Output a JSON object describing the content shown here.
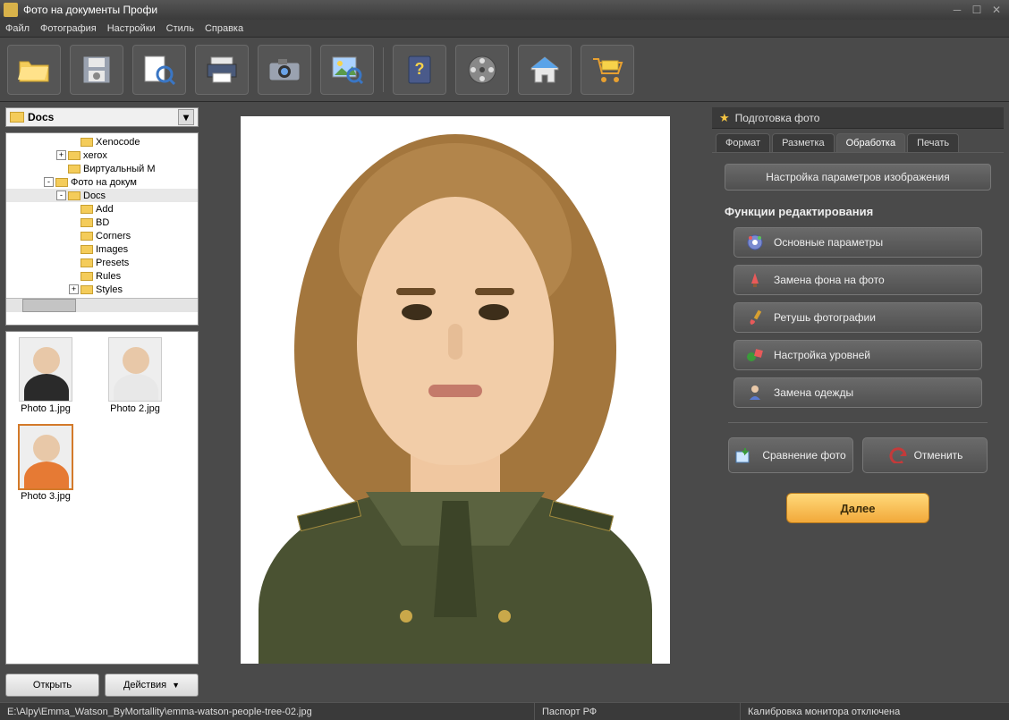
{
  "app": {
    "title": "Фото на документы Профи"
  },
  "menu": {
    "file": "Файл",
    "photo": "Фотография",
    "settings": "Настройки",
    "style": "Стиль",
    "help": "Справка"
  },
  "toolbar": {
    "items": [
      {
        "name": "open-folder-icon"
      },
      {
        "name": "save-icon"
      },
      {
        "name": "preview-icon"
      },
      {
        "name": "print-icon"
      },
      {
        "name": "camera-icon"
      },
      {
        "name": "image-search-icon"
      },
      {
        "sep": true
      },
      {
        "name": "help-book-icon"
      },
      {
        "name": "film-reel-icon"
      },
      {
        "name": "home-icon"
      },
      {
        "name": "shopping-cart-icon"
      }
    ]
  },
  "left": {
    "path_label": "Docs",
    "tree": [
      {
        "indent": 5,
        "label": "Xenocode",
        "exp": ""
      },
      {
        "indent": 4,
        "label": "xerox",
        "exp": "+"
      },
      {
        "indent": 4,
        "label": "Виртуальный М",
        "exp": ""
      },
      {
        "indent": 3,
        "label": "Фото на докум",
        "exp": "-"
      },
      {
        "indent": 4,
        "label": "Docs",
        "exp": "-",
        "sel": true
      },
      {
        "indent": 5,
        "label": "Add",
        "exp": ""
      },
      {
        "indent": 5,
        "label": "BD",
        "exp": ""
      },
      {
        "indent": 5,
        "label": "Corners",
        "exp": ""
      },
      {
        "indent": 5,
        "label": "Images",
        "exp": ""
      },
      {
        "indent": 5,
        "label": "Presets",
        "exp": ""
      },
      {
        "indent": 5,
        "label": "Rules",
        "exp": ""
      },
      {
        "indent": 5,
        "label": "Styles",
        "exp": "+"
      }
    ],
    "thumbs": [
      {
        "label": "Photo 1.jpg",
        "head": "#e8c8a8",
        "body": "#2a2a2a",
        "selected": false
      },
      {
        "label": "Photo 2.jpg",
        "head": "#e8c8a8",
        "body": "#e8e8e8",
        "selected": false
      },
      {
        "label": "Photo 3.jpg",
        "head": "#e8c8a8",
        "body": "#e67a34",
        "selected": true
      }
    ],
    "open_btn": "Открыть",
    "actions_btn": "Действия"
  },
  "right": {
    "header": "Подготовка фото",
    "tabs": {
      "format": "Формат",
      "markup": "Разметка",
      "processing": "Обработка",
      "print": "Печать"
    },
    "active_tab": "processing",
    "wide_btn": "Настройка параметров изображения",
    "section_title": "Функции редактирования",
    "funcs": [
      {
        "icon": "gear-icon",
        "label": "Основные параметры"
      },
      {
        "icon": "background-replace-icon",
        "label": "Замена фона на фото"
      },
      {
        "icon": "brush-icon",
        "label": "Ретушь фотографии"
      },
      {
        "icon": "levels-icon",
        "label": "Настройка уровней"
      },
      {
        "icon": "clothes-icon",
        "label": "Замена одежды"
      }
    ],
    "compare_btn": "Сравнение фото",
    "cancel_btn": "Отменить",
    "next_btn": "Далее"
  },
  "status": {
    "path": "E:\\Alpy\\Emma_Watson_ByMortallity\\emma-watson-people-tree-02.jpg",
    "format": "Паспорт РФ",
    "calibration": "Калибровка монитора отключена"
  }
}
